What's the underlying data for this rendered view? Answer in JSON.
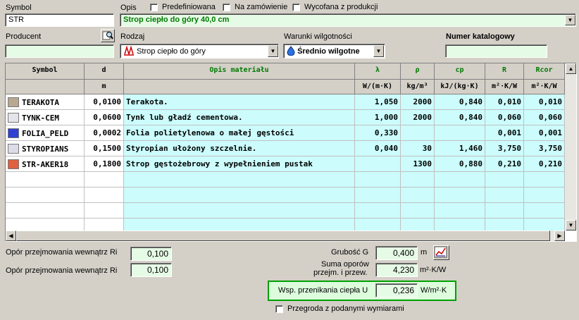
{
  "header": {
    "symbol_label": "Symbol",
    "symbol_value": "STR",
    "opis_label": "Opis",
    "opis_value": "Strop ciepło do góry 40,0 cm",
    "checks": [
      {
        "label": "Predefiniowana",
        "checked": false
      },
      {
        "label": "Na zamówienie",
        "checked": false
      },
      {
        "label": "Wycofana z produkcji",
        "checked": false
      }
    ],
    "producent_label": "Producent",
    "producent_value": "",
    "rodzaj_label": "Rodzaj",
    "rodzaj_value": "Strop ciepło do góry",
    "wilgotnosc_label": "Warunki wilgotności",
    "wilgotnosc_value": "Średnio wilgotne",
    "katalog_label": "Numer katalogowy",
    "katalog_value": ""
  },
  "table": {
    "columns": [
      {
        "title": "Symbol",
        "unit": ""
      },
      {
        "title": "d",
        "unit": "m"
      },
      {
        "title": "Opis materiału",
        "unit": ""
      },
      {
        "title": "λ",
        "unit": "W/(m·K)"
      },
      {
        "title": "ρ",
        "unit": "kg/m³"
      },
      {
        "title": "cp",
        "unit": "kJ/(kg·K)"
      },
      {
        "title": "R",
        "unit": "m²·K/W"
      },
      {
        "title": "Rcor",
        "unit": "m²·K/W"
      }
    ],
    "rows": [
      {
        "symbol": "TERAKOTA",
        "swatch": "#b8a890",
        "d": "0,0100",
        "opis": "Terakota.",
        "lambda": "1,050",
        "rho": "2000",
        "cp": "0,840",
        "r": "0,010",
        "rcor": "0,010"
      },
      {
        "symbol": "TYNK-CEM",
        "swatch": "#e4e4ec",
        "d": "0,0600",
        "opis": "Tynk lub gładź cementowa.",
        "lambda": "1,000",
        "rho": "2000",
        "cp": "0,840",
        "r": "0,060",
        "rcor": "0,060"
      },
      {
        "symbol": "FOLIA_PELD",
        "swatch": "#3040d0",
        "d": "0,0002",
        "opis": "Folia polietylenowa o małej gęstości",
        "lambda": "0,330",
        "rho": "",
        "cp": "",
        "r": "0,001",
        "rcor": "0,001"
      },
      {
        "symbol": "STYROPIANS",
        "swatch": "#dcdce8",
        "d": "0,1500",
        "opis": "Styropian ułożony szczelnie.",
        "lambda": "0,040",
        "rho": "30",
        "cp": "1,460",
        "r": "3,750",
        "rcor": "3,750"
      },
      {
        "symbol": "STR-AKER18",
        "swatch": "#e06040",
        "d": "0,1800",
        "opis": "Strop gęstożebrowy z wypełnieniem pustak",
        "lambda": "",
        "rho": "1300",
        "cp": "0,880",
        "r": "0,210",
        "rcor": "0,210"
      }
    ]
  },
  "bottom": {
    "opor1_label": "Opór przejmowania wewnątrz Ri",
    "opor1_value": "0,100",
    "opor2_label": "Opór przejmowania wewnątrz Ri",
    "opor2_value": "0,100",
    "grubosc_label": "Grubość G",
    "grubosc_value": "0,400",
    "grubosc_unit": "m",
    "suma_label_1": "Suma oporów",
    "suma_label_2": "przejm. i przew.",
    "suma_value": "4,230",
    "suma_unit": "m²·K/W",
    "u_label": "Wsp. przenikania ciepła U",
    "u_value": "0,236",
    "u_unit": "W/m²·K",
    "przegroda_label": "Przegroda z podanymi wymiarami",
    "przegroda_checked": false
  }
}
